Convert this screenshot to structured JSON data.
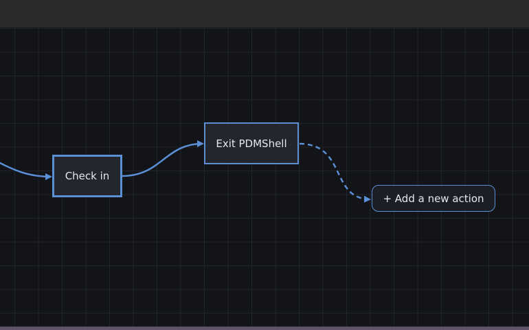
{
  "colors": {
    "accent": "#5b8fd6",
    "canvas_bg": "#121417",
    "node_bg": "#23272d",
    "text": "#e6e8eb"
  },
  "nodes": {
    "check_in": {
      "label": "Check in"
    },
    "exit_pdmshell": {
      "label": "Exit PDMShell"
    }
  },
  "add_action": {
    "label": "+ Add a new action"
  }
}
